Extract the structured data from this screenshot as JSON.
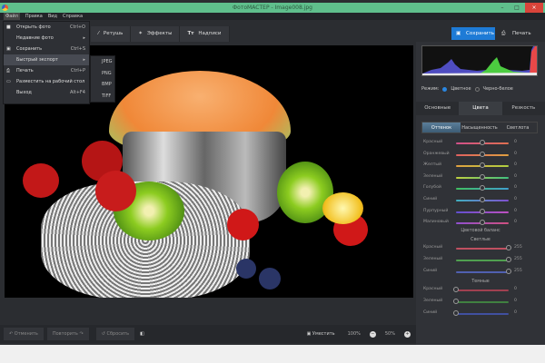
{
  "window": {
    "title": "ФотоМАСТЕР - Image008.jpg",
    "minimize": "–",
    "maximize": "□",
    "close": "×"
  },
  "menubar": [
    "Файл",
    "Правка",
    "Вид",
    "Справка"
  ],
  "file_menu": [
    {
      "label": "Открыть фото",
      "shortcut": "Ctrl+O",
      "icon": "folder-icon"
    },
    {
      "label": "Недавние фото",
      "shortcut": "▸"
    },
    {
      "label": "Сохранить",
      "shortcut": "Ctrl+S",
      "icon": "save-icon"
    },
    {
      "label": "Быстрый экспорт",
      "shortcut": "▸",
      "highlighted": true
    },
    {
      "label": "Печать",
      "shortcut": "Ctrl+P",
      "icon": "printer-icon"
    },
    {
      "label": "Разместить на рабочий стол",
      "shortcut": "",
      "icon": "monitor-icon"
    },
    {
      "label": "Выход",
      "shortcut": "Alt+F4"
    }
  ],
  "export_submenu": [
    "JPEG",
    "PNG",
    "BMP",
    "TIFF"
  ],
  "toolbar": {
    "retouch": "Ретушь",
    "effects": "Эффекты",
    "text": "Надписи",
    "save": "Сохранить",
    "print": "Печать"
  },
  "right": {
    "mode_label": "Режим:",
    "mode_color": "Цветное",
    "mode_bw": "Черно-белое",
    "mode_selected": "Цветное",
    "tabs": [
      "Основные",
      "Цвета",
      "Резкость"
    ],
    "active_tab": "Цвета",
    "subtabs": [
      "Оттенок",
      "Насыщенность",
      "Светлота"
    ],
    "active_subtab": "Оттенок",
    "hue_rows": [
      {
        "label": "Красный",
        "value": "0",
        "c1": "#d0508a",
        "c2": "#e07050"
      },
      {
        "label": "Оранжевый",
        "value": "0",
        "c1": "#e06060",
        "c2": "#e0a040"
      },
      {
        "label": "Желтый",
        "value": "0",
        "c1": "#e0a040",
        "c2": "#b0d040"
      },
      {
        "label": "Зеленый",
        "value": "0",
        "c1": "#c0d040",
        "c2": "#40c080"
      },
      {
        "label": "Голубой",
        "value": "0",
        "c1": "#40c060",
        "c2": "#40a0d0"
      },
      {
        "label": "Синий",
        "value": "0",
        "c1": "#40b0c0",
        "c2": "#8050d0"
      },
      {
        "label": "Пурпурный",
        "value": "0",
        "c1": "#6050d0",
        "c2": "#c050c0"
      },
      {
        "label": "Малиновый",
        "value": "0",
        "c1": "#9050d0",
        "c2": "#d05080"
      }
    ],
    "balance_title": "Цветовой баланс",
    "lights_title": "Светлые",
    "lights": [
      {
        "label": "Красный",
        "value": "255",
        "c": "#c05060",
        "level": 1
      },
      {
        "label": "Зеленый",
        "value": "255",
        "c": "#50a050",
        "level": 1
      },
      {
        "label": "Синий",
        "value": "255",
        "c": "#5060b0",
        "level": 1
      }
    ],
    "darks_title": "Темные",
    "darks": [
      {
        "label": "Красный",
        "value": "0",
        "c": "#a04050",
        "level": 0
      },
      {
        "label": "Зеленый",
        "value": "0",
        "c": "#408040",
        "level": 0
      },
      {
        "label": "Синий",
        "value": "0",
        "c": "#4050a0",
        "level": 0
      }
    ]
  },
  "bottom": {
    "undo": "Отменить",
    "redo": "Повторить",
    "reset": "Сбросить",
    "fit": "Уместить",
    "zoom100": "100%",
    "zoom": "50%"
  }
}
